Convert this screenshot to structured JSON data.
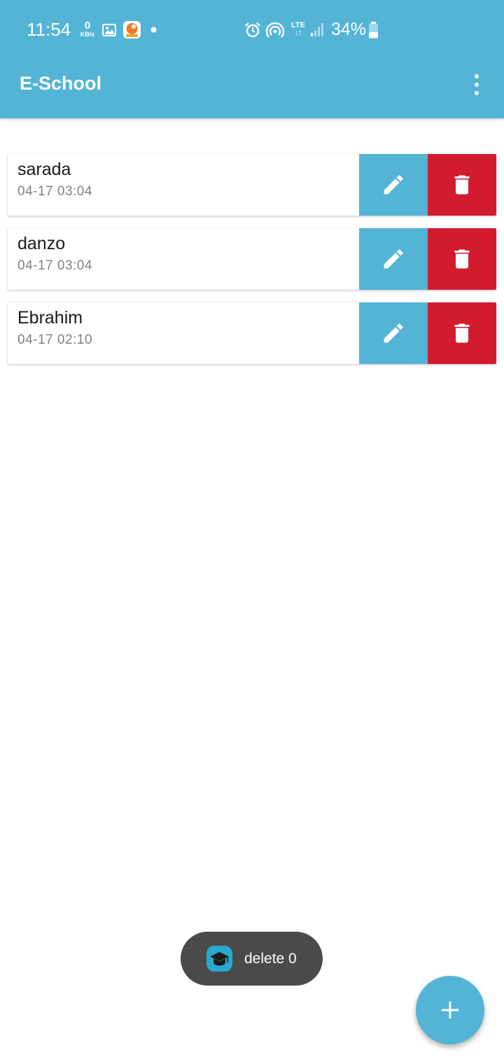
{
  "status_bar": {
    "time": "11:54",
    "net_speed_value": "0",
    "net_speed_unit": "KB/s",
    "network_type": "LTE",
    "battery": "34%",
    "icons": [
      "gallery-icon",
      "app-notification-icon",
      "dot-icon",
      "alarm-icon",
      "hotspot-icon",
      "lte-data-icon",
      "signal-icon",
      "battery-icon"
    ]
  },
  "app_bar": {
    "title": "E-School",
    "menu_icon": "more-vert-icon"
  },
  "students": [
    {
      "name": "sarada",
      "time": "04-17  03:04"
    },
    {
      "name": "danzo",
      "time": "04-17  03:04"
    },
    {
      "name": "Ebrahim",
      "time": "04-17  02:10"
    }
  ],
  "row_actions": {
    "edit_icon": "pencil-icon",
    "delete_icon": "trash-icon",
    "edit_color": "#53b4d6",
    "delete_color": "#d21b2e"
  },
  "toast": {
    "message": "delete 0",
    "icon": "graduation-cap-icon"
  },
  "fab": {
    "icon": "plus-icon"
  },
  "colors": {
    "primary": "#53b4d6",
    "danger": "#d21b2e",
    "toast_bg": "#4a4a4a"
  }
}
